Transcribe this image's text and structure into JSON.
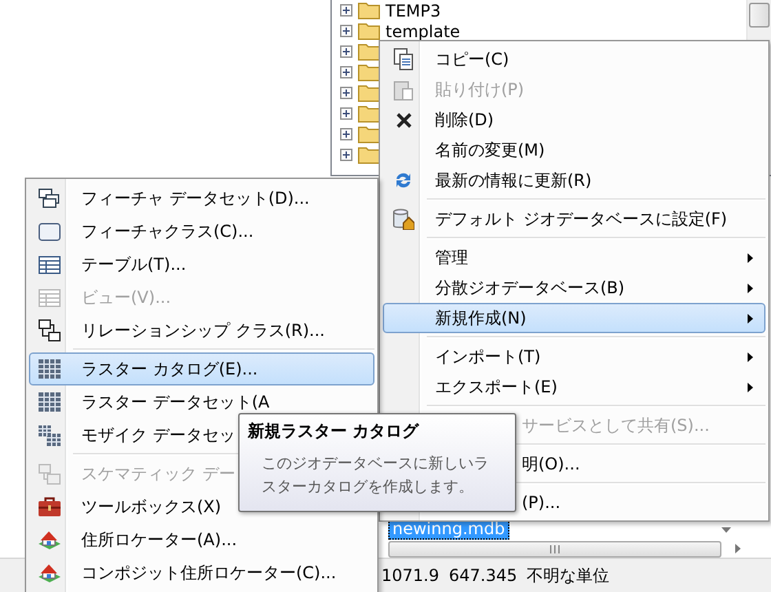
{
  "tree": {
    "rows": [
      {
        "label": "TEMP3",
        "expanded": false
      },
      {
        "label": "template",
        "expanded": false
      },
      {
        "expanded": false
      },
      {
        "expanded": false
      },
      {
        "expanded": false
      },
      {
        "expanded": false
      },
      {
        "expanded": false
      },
      {
        "expanded": false
      }
    ]
  },
  "main_menu": {
    "items": [
      {
        "kind": "item",
        "label": "コピー(C)",
        "disabled": false,
        "selected": false,
        "submenu": false
      },
      {
        "kind": "item",
        "label": "貼り付け(P)",
        "disabled": true,
        "selected": false,
        "submenu": false
      },
      {
        "kind": "item",
        "label": "削除(D)",
        "disabled": false,
        "selected": false,
        "submenu": false
      },
      {
        "kind": "item",
        "label": "名前の変更(M)",
        "disabled": false,
        "selected": false,
        "submenu": false
      },
      {
        "kind": "item",
        "label": "最新の情報に更新(R)",
        "disabled": false,
        "selected": false,
        "submenu": false
      },
      {
        "kind": "separator"
      },
      {
        "kind": "item",
        "label": "デフォルト ジオデータベースに設定(F)",
        "disabled": false,
        "selected": false,
        "submenu": false
      },
      {
        "kind": "separator"
      },
      {
        "kind": "item",
        "label": "管理",
        "disabled": false,
        "selected": false,
        "submenu": true
      },
      {
        "kind": "item",
        "label": "分散ジオデータベース(B)",
        "disabled": false,
        "selected": false,
        "submenu": true
      },
      {
        "kind": "item",
        "label": "新規作成(N)",
        "disabled": false,
        "selected": true,
        "submenu": true
      },
      {
        "kind": "separator"
      },
      {
        "kind": "item",
        "label": "インポート(T)",
        "disabled": false,
        "selected": false,
        "submenu": true
      },
      {
        "kind": "item",
        "label": "エクスポート(E)",
        "disabled": false,
        "selected": false,
        "submenu": true
      },
      {
        "kind": "separator"
      },
      {
        "kind": "clipped",
        "label": "サービスとして共有(S)...",
        "disabled": true,
        "selected": false,
        "submenu": false
      },
      {
        "kind": "separator"
      },
      {
        "kind": "clipped",
        "label": "明(O)...",
        "disabled": false,
        "selected": false,
        "submenu": false
      },
      {
        "kind": "separator"
      },
      {
        "kind": "clipped",
        "label": "(P)...",
        "disabled": false,
        "selected": false,
        "submenu": false
      }
    ]
  },
  "submenu": {
    "items": [
      {
        "kind": "item",
        "label": "フィーチャ データセット(D)...",
        "disabled": false,
        "selected": false
      },
      {
        "kind": "item",
        "label": "フィーチャクラス(C)...",
        "disabled": false,
        "selected": false
      },
      {
        "kind": "item",
        "label": "テーブル(T)...",
        "disabled": false,
        "selected": false
      },
      {
        "kind": "item",
        "label": "ビュー(V)...",
        "disabled": true,
        "selected": false
      },
      {
        "kind": "item",
        "label": "リレーションシップ クラス(R)...",
        "disabled": false,
        "selected": false
      },
      {
        "kind": "separator"
      },
      {
        "kind": "item",
        "label": "ラスター カタログ(E)...",
        "disabled": false,
        "selected": true
      },
      {
        "kind": "item",
        "label": "ラスター データセット(A",
        "disabled": false,
        "selected": false
      },
      {
        "kind": "item",
        "label": "モザイク データセッ",
        "disabled": false,
        "selected": false
      },
      {
        "kind": "separator"
      },
      {
        "kind": "item",
        "label": "スケマティック デー",
        "disabled": true,
        "selected": false
      },
      {
        "kind": "item",
        "label": "ツールボックス(X)",
        "disabled": false,
        "selected": false
      },
      {
        "kind": "item",
        "label": "住所ロケーター(A)...",
        "disabled": false,
        "selected": false
      },
      {
        "kind": "item",
        "label": "コンポジット住所ロケーター(C)...",
        "disabled": false,
        "selected": false
      }
    ]
  },
  "tooltip": {
    "title": "新規ラスター カタログ",
    "text": "このジオデータベースに新しいラスターカタログを作成します。"
  },
  "name_field": {
    "value": "newinng.mdb",
    "text_selected": true
  },
  "status_bar": {
    "items": [
      "1071.9",
      "647.345",
      "不明な単位"
    ]
  }
}
